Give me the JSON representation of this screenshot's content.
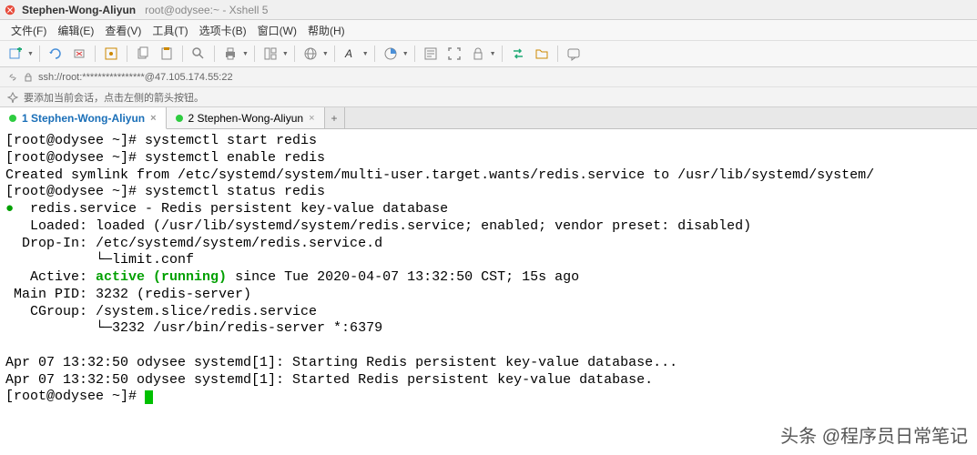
{
  "titlebar": {
    "main": "Stephen-Wong-Aliyun",
    "sub": "root@odysee:~ - Xshell 5"
  },
  "menubar": {
    "file": "文件(F)",
    "edit": "编辑(E)",
    "view": "查看(V)",
    "tools": "工具(T)",
    "tabs": "选项卡(B)",
    "window": "窗口(W)",
    "help": "帮助(H)"
  },
  "addressbar": {
    "text": "ssh://root:****************@47.105.174.55:22"
  },
  "hintbar": {
    "text": "要添加当前会话，点击左侧的箭头按钮。"
  },
  "tabs": [
    {
      "label": "1 Stephen-Wong-Aliyun",
      "active": true
    },
    {
      "label": "2 Stephen-Wong-Aliyun",
      "active": false
    }
  ],
  "terminal": {
    "lines": [
      {
        "t": "[root@odysee ~]# systemctl start redis"
      },
      {
        "t": "[root@odysee ~]# systemctl enable redis"
      },
      {
        "t": "Created symlink from /etc/systemd/system/multi-user.target.wants/redis.service to /usr/lib/systemd/system/"
      },
      {
        "t": "[root@odysee ~]# systemctl status redis"
      },
      {
        "dot": true,
        "t": "   redis.service - Redis persistent key-value database"
      },
      {
        "t": "   Loaded: loaded (/usr/lib/systemd/system/redis.service; enabled; vendor preset: disabled)"
      },
      {
        "t": "  Drop-In: /etc/systemd/system/redis.service.d"
      },
      {
        "t": "           └─limit.conf"
      },
      {
        "pre": "   Active: ",
        "green": "active (running)",
        "post": " since Tue 2020-04-07 13:32:50 CST; 15s ago"
      },
      {
        "t": " Main PID: 3232 (redis-server)"
      },
      {
        "t": "   CGroup: /system.slice/redis.service"
      },
      {
        "t": "           └─3232 /usr/bin/redis-server *:6379"
      },
      {
        "t": ""
      },
      {
        "t": "Apr 07 13:32:50 odysee systemd[1]: Starting Redis persistent key-value database..."
      },
      {
        "t": "Apr 07 13:32:50 odysee systemd[1]: Started Redis persistent key-value database."
      },
      {
        "t": "[root@odysee ~]# ",
        "cursor": true
      }
    ]
  },
  "watermark": "头条 @程序员日常笔记"
}
